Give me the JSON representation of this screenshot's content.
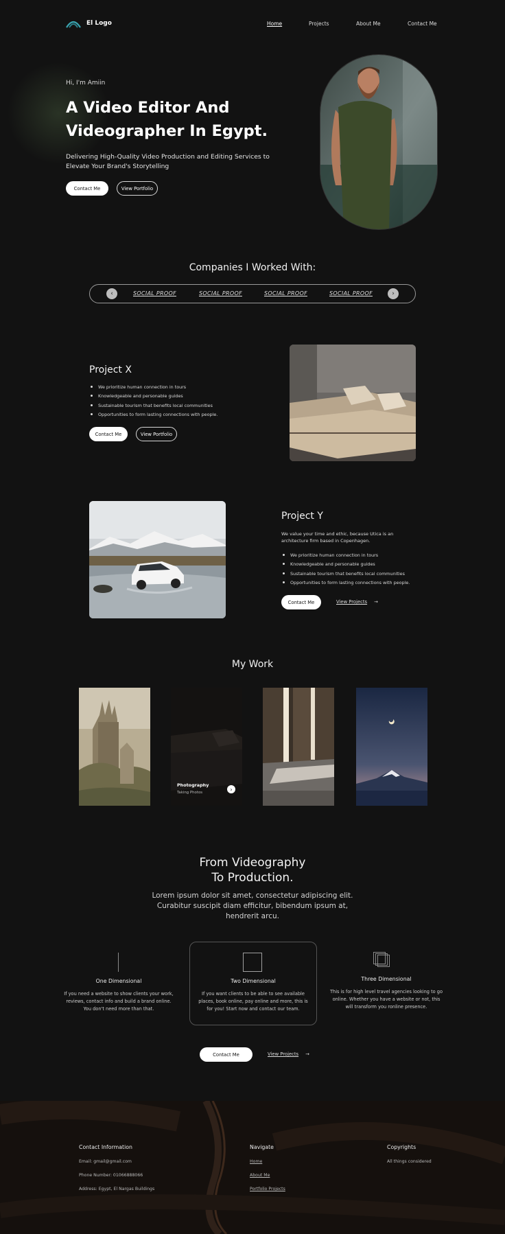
{
  "nav": {
    "logo_text": "El Logo",
    "items": [
      "Home",
      "Projects",
      "About Me",
      "Contact Me"
    ]
  },
  "hero": {
    "greeting": "Hi, I'm Amiin",
    "title_line1": "A Video Editor And",
    "title_line2": "Videographer In Egypt.",
    "subtitle": "Delivering High-Quality Video Production and Editing Services to Elevate Your Brand's Storytelling",
    "primary_btn": "Contact Me",
    "secondary_btn": "View Portfolio"
  },
  "companies": {
    "title": "Companies I Worked With:",
    "logos": [
      "SOCIAL PROOF",
      "SOCIAL PROOF",
      "SOCIAL PROOF",
      "SOCIAL PROOF"
    ]
  },
  "project_x": {
    "title": "Project X",
    "bullets": [
      "We prioritize human connection in tours",
      "Knowledgeable and personable guides",
      "Sustainable tourism that benefits local communities",
      "Opportunities to form lasting connections with people."
    ],
    "primary_btn": "Contact Me",
    "secondary_btn": "View Portfolio"
  },
  "project_y": {
    "title": "Project Y",
    "description": "We value your time and ethic, because Utica is an architecture firm based in Copenhagen.",
    "bullets": [
      "We prioritize human connection in tours",
      "Knowledgeable and personable guides",
      "Sustainable tourism that benefits local communities",
      "Opportunities to form lasting connections with people."
    ],
    "primary_btn": "Contact Me",
    "link": "View Projects"
  },
  "work": {
    "title": "My Work",
    "card_title": "Photography",
    "card_sub": "Taking Photos"
  },
  "production": {
    "title_line1": "From Videography",
    "title_line2": "To Production.",
    "subtitle": "Lorem ipsum dolor sit amet, consectetur adipiscing elit. Curabitur suscipit diam efficitur, bibendum ipsum at, hendrerit arcu.",
    "features": [
      {
        "title": "One Dimensional",
        "desc": "If you need a website to show clients your work, reviews, contact info and build a brand online. You don't need more than that."
      },
      {
        "title": "Two Dimensional",
        "desc": "If you want clients to be able to see available places, book online, pay online and more, this is for you! Start now and contact our team."
      },
      {
        "title": "Three Dimensional",
        "desc": "This is for high level travel agencies looking to go online. Whether you have a website or not, this will transform you ronline presence."
      }
    ],
    "primary_btn": "Contact Me",
    "link": "View Projects"
  },
  "footer": {
    "contact_title": "Contact Information",
    "email": "Email: gmail@gmail.com",
    "phone": "Phone Number: 01066888066",
    "address": "Address: Egypt, El Nargas Buildings",
    "navigate_title": "Navigate",
    "nav_links": [
      "Home",
      "About Me",
      "Portfolio Projects"
    ],
    "copyright_title": "Copyrights",
    "copyright_text": "All things considered"
  }
}
